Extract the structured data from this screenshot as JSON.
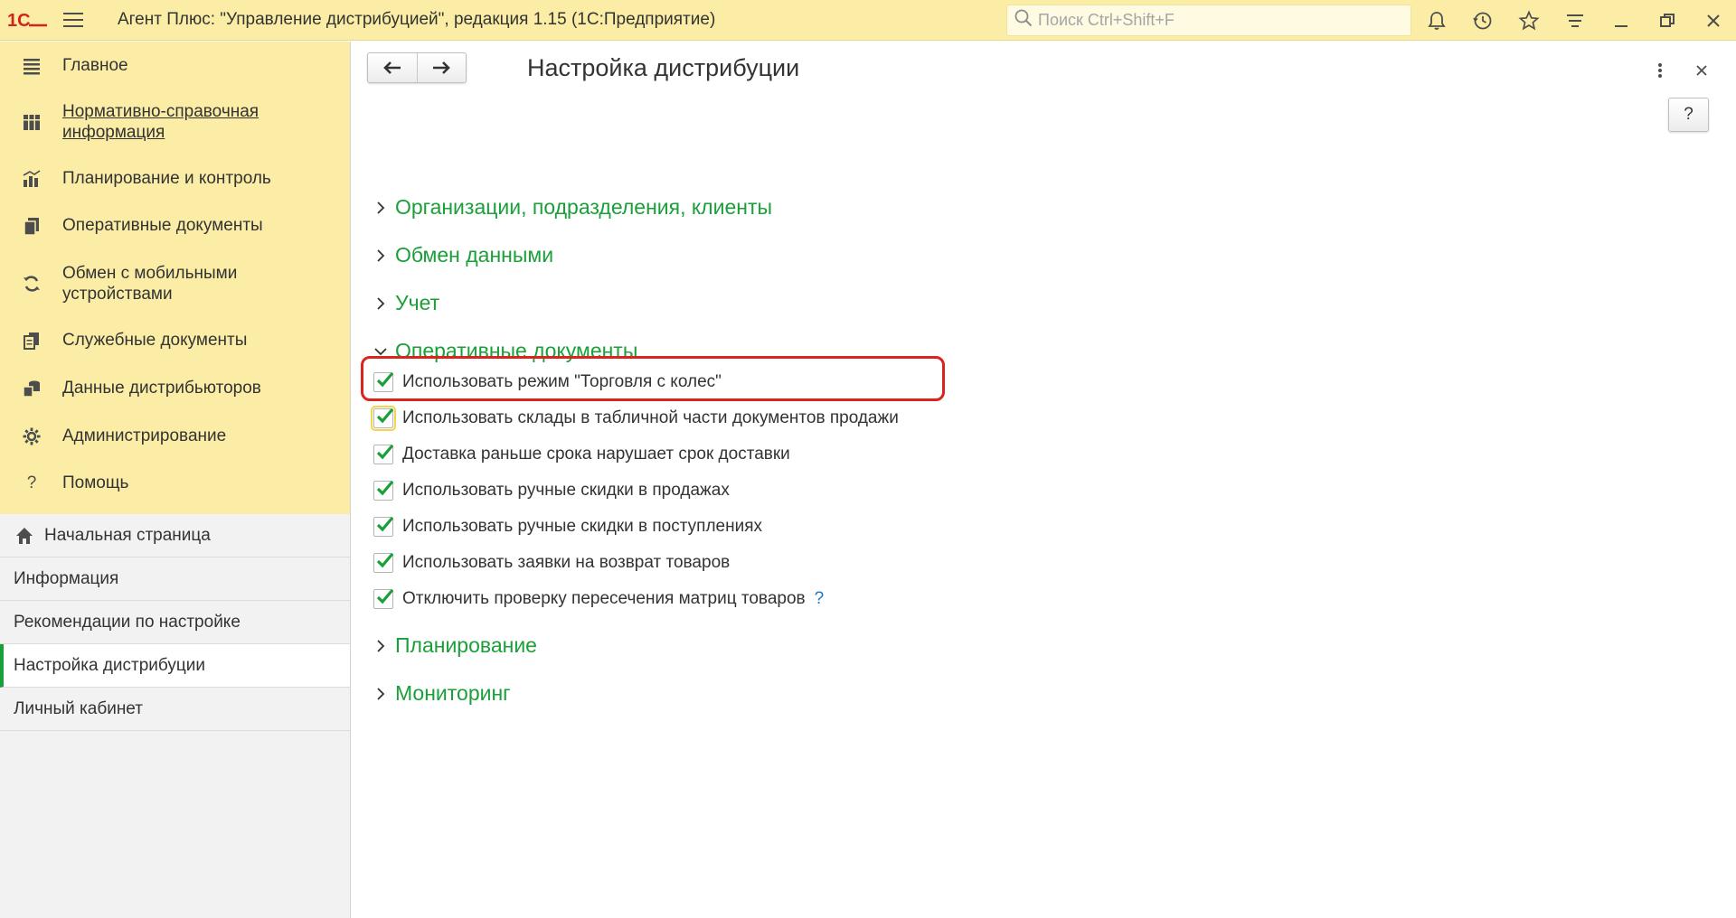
{
  "app": {
    "title": "Агент Плюс: \"Управление дистрибуцией\", редакция 1.15  (1С:Предприятие)",
    "logo_text": "1С",
    "search_placeholder": "Поиск Ctrl+Shift+F"
  },
  "sidebar": {
    "menu": [
      {
        "label": "Главное",
        "icon": "list-icon"
      },
      {
        "label": "Нормативно-справочная информация",
        "icon": "catalog-icon"
      },
      {
        "label": "Планирование и контроль",
        "icon": "chart-icon"
      },
      {
        "label": "Оперативные документы",
        "icon": "documents-icon"
      },
      {
        "label": "Обмен с мобильными устройствами",
        "icon": "sync-icon"
      },
      {
        "label": "Служебные документы",
        "icon": "service-documents-icon"
      },
      {
        "label": "Данные дистрибьюторов",
        "icon": "distributor-data-icon"
      },
      {
        "label": "Администрирование",
        "icon": "gear-icon"
      },
      {
        "label": "Помощь",
        "icon": "question-icon"
      }
    ],
    "open_pages": [
      {
        "label": "Начальная страница"
      },
      {
        "label": "Информация"
      },
      {
        "label": "Рекомендации по настройке"
      },
      {
        "label": "Настройка дистрибуции"
      },
      {
        "label": "Личный кабинет"
      }
    ]
  },
  "content": {
    "title": "Настройка дистрибуции",
    "help_label": "?",
    "sections": [
      {
        "label": "Организации, подразделения, клиенты",
        "expanded": false
      },
      {
        "label": "Обмен данными",
        "expanded": false
      },
      {
        "label": "Учет",
        "expanded": false
      },
      {
        "label": "Оперативные документы",
        "expanded": true
      },
      {
        "label": "Планирование",
        "expanded": false
      },
      {
        "label": "Мониторинг",
        "expanded": false
      }
    ],
    "checkboxes": [
      {
        "label": "Использовать режим \"Торговля с колес\"",
        "checked": true
      },
      {
        "label": "Использовать склады в табличной части документов продажи",
        "checked": true
      },
      {
        "label": "Доставка раньше срока нарушает срок доставки",
        "checked": true
      },
      {
        "label": "Использовать ручные скидки в продажах",
        "checked": true
      },
      {
        "label": "Использовать ручные скидки в поступлениях",
        "checked": true
      },
      {
        "label": "Использовать заявки на возврат товаров",
        "checked": true
      },
      {
        "label": "Отключить проверку пересечения матриц товаров",
        "checked": true
      }
    ],
    "tooltip_mark": "?"
  },
  "colors": {
    "topbar": "#fbeda6",
    "accent_green": "#1a9f39",
    "highlight_red": "#d9251d"
  }
}
